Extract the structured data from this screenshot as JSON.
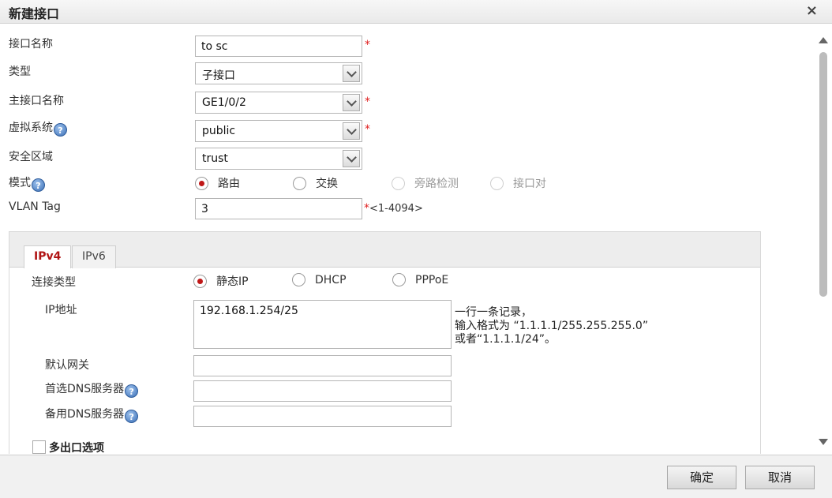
{
  "dialog": {
    "title": "新建接口",
    "close_icon": "×"
  },
  "form": {
    "name_label": "接口名称",
    "name_value": "to sc",
    "type_label": "类型",
    "type_value": "子接口",
    "parent_label": "主接口名称",
    "parent_value": "GE1/0/2",
    "vsys_label": "虚拟系统",
    "vsys_value": "public",
    "zone_label": "安全区域",
    "zone_value": "trust",
    "mode_label": "模式",
    "mode_options": [
      "路由",
      "交换",
      "旁路检测",
      "接口对"
    ],
    "mode_selected": "路由",
    "vlan_label": "VLAN Tag",
    "vlan_value": "3",
    "vlan_range": "<1-4094>",
    "required_mark": "*",
    "help_icon": "?"
  },
  "tabs": [
    {
      "label": "IPv4",
      "active": true
    },
    {
      "label": "IPv6",
      "active": false
    }
  ],
  "ipv4": {
    "conn_type_label": "连接类型",
    "conn_options": [
      "静态IP",
      "DHCP",
      "PPPoE"
    ],
    "conn_selected": "静态IP",
    "ip_label": "IP地址",
    "ip_value": "192.168.1.254/25",
    "ip_hint": [
      "一行一条记录，",
      "输入格式为 “1.1.1.1/255.255.255.0”",
      "或者“1.1.1.1/24”。"
    ],
    "gateway_label": "默认网关",
    "gateway_value": "",
    "dns1_label": "首选DNS服务器",
    "dns1_value": "",
    "dns2_label": "备用DNS服务器",
    "dns2_value": "",
    "multi_exit_label": "多出口选项"
  },
  "footer": {
    "ok_label": "确定",
    "cancel_label": "取消"
  },
  "colors": {
    "accent": "#b01414",
    "required": "#e02020",
    "help": "#3b6fb6"
  }
}
